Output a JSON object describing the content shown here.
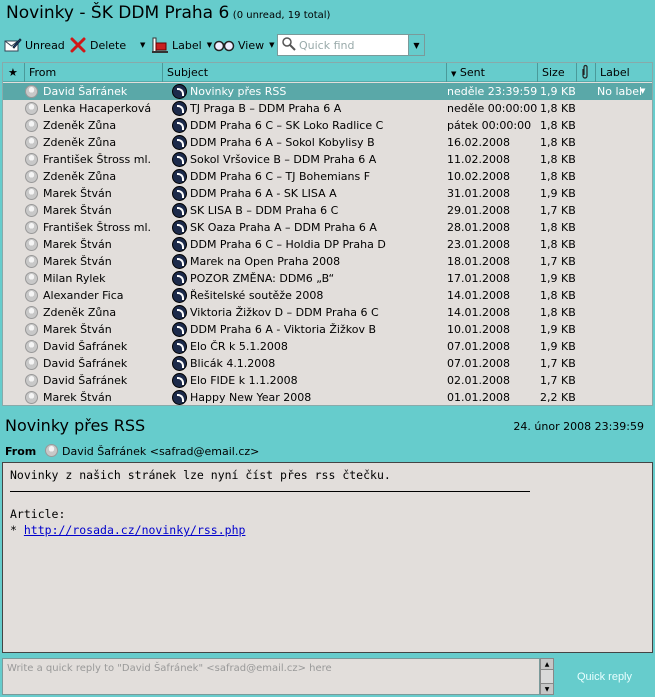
{
  "window": {
    "title": "Novinky - ŠK DDM Praha 6",
    "subtitle": "(0 unread, 19 total)"
  },
  "toolbar": {
    "unread_label": "Unread",
    "delete_label": "Delete",
    "label_label": "Label",
    "view_label": "View",
    "quickfind_placeholder": "Quick find"
  },
  "columns": {
    "star": "★",
    "from": "From",
    "subject": "Subject",
    "sent": "Sent",
    "size": "Size",
    "label": "Label"
  },
  "messages": [
    {
      "from": "David Šafránek",
      "subject": "Novinky přes RSS",
      "sent": "neděle 23:39:59",
      "size": "1,9 KB",
      "label": "No label"
    },
    {
      "from": "Lenka Hacaperková",
      "subject": "TJ Praga B – DDM Praha 6 A",
      "sent": "neděle 00:00:00",
      "size": "1,8 KB",
      "label": ""
    },
    {
      "from": "Zdeněk Zůna",
      "subject": "DDM Praha 6 C – SK Loko Radlice C",
      "sent": "pátek 00:00:00",
      "size": "1,8 KB",
      "label": ""
    },
    {
      "from": "Zdeněk Zůna",
      "subject": "DDM Praha 6 A – Sokol Kobylisy B",
      "sent": "16.02.2008",
      "size": "1,8 KB",
      "label": ""
    },
    {
      "from": "František Štross ml.",
      "subject": "Sokol Vršovice B – DDM Praha 6 A",
      "sent": "11.02.2008",
      "size": "1,8 KB",
      "label": ""
    },
    {
      "from": "Zdeněk Zůna",
      "subject": "DDM Praha 6 C – TJ Bohemians F",
      "sent": "10.02.2008",
      "size": "1,8 KB",
      "label": ""
    },
    {
      "from": "Marek Štván",
      "subject": "DDM Praha 6 A - SK LISA A",
      "sent": "31.01.2008",
      "size": "1,9 KB",
      "label": ""
    },
    {
      "from": "Marek Štván",
      "subject": "SK LISA B – DDM Praha 6 C",
      "sent": "29.01.2008",
      "size": "1,7 KB",
      "label": ""
    },
    {
      "from": "František Štross ml.",
      "subject": "SK Oaza Praha A – DDM Praha 6 A",
      "sent": "28.01.2008",
      "size": "1,8 KB",
      "label": ""
    },
    {
      "from": "Marek Štván",
      "subject": "DDM Praha 6 C – Holdia DP Praha D",
      "sent": "23.01.2008",
      "size": "1,8 KB",
      "label": ""
    },
    {
      "from": "Marek Štván",
      "subject": "Marek na Open Praha 2008",
      "sent": "18.01.2008",
      "size": "1,7 KB",
      "label": ""
    },
    {
      "from": "Milan Rylek",
      "subject": "POZOR ZMĚNA: DDM6 „B“",
      "sent": "17.01.2008",
      "size": "1,9 KB",
      "label": ""
    },
    {
      "from": "Alexander Fica",
      "subject": "Řešitelské soutěže 2008",
      "sent": "14.01.2008",
      "size": "1,8 KB",
      "label": ""
    },
    {
      "from": "Zdeněk Zůna",
      "subject": "Viktoria Žižkov D – DDM Praha 6 C",
      "sent": "14.01.2008",
      "size": "1,8 KB",
      "label": ""
    },
    {
      "from": "Marek Štván",
      "subject": "DDM Praha 6 A - Viktoria Žižkov B",
      "sent": "10.01.2008",
      "size": "1,9 KB",
      "label": ""
    },
    {
      "from": "David Šafránek",
      "subject": "Elo ČR k 5.1.2008",
      "sent": "07.01.2008",
      "size": "1,9 KB",
      "label": ""
    },
    {
      "from": "David Šafránek",
      "subject": "Blicák 4.1.2008",
      "sent": "07.01.2008",
      "size": "1,7 KB",
      "label": ""
    },
    {
      "from": "David Šafránek",
      "subject": "Elo FIDE k 1.1.2008",
      "sent": "02.01.2008",
      "size": "1,7 KB",
      "label": ""
    },
    {
      "from": "Marek Štván",
      "subject": "Happy New Year 2008",
      "sent": "01.01.2008",
      "size": "2,2 KB",
      "label": ""
    }
  ],
  "selected_index": 0,
  "message": {
    "subject": "Novinky přes RSS",
    "date": "24. únor 2008 23:39:59",
    "from_label": "From",
    "from": "David Šafránek <safrad@email.cz>",
    "body_line": "Novinky z našich stránek lze nyní číst přes rss čtečku.",
    "article_label": "Article:",
    "link_bullet": "*",
    "link": "http://rosada.cz/novinky/rss.php"
  },
  "reply": {
    "placeholder": "Write a quick reply to \"David Šafránek\" <safrad@email.cz> here",
    "button": "Quick reply"
  },
  "colors": {
    "accent": "#66cccc",
    "selected_row": "#5aa8a8",
    "pane_bg": "#e2dedb"
  }
}
